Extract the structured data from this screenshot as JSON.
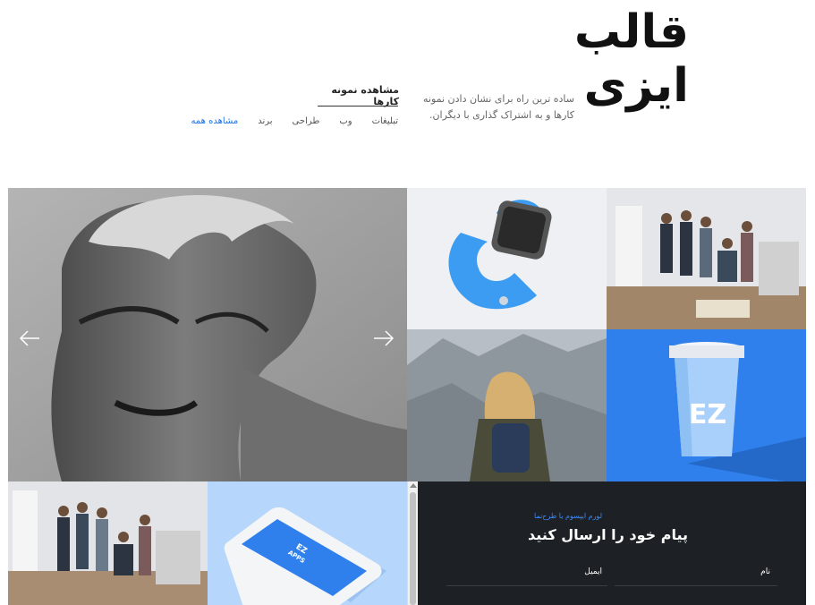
{
  "header": {
    "site_title": "قالب ایزی",
    "tagline": "ساده ترین راه برای نشان دادن نمونه کارها و به اشتراک گذاری با دیگران.",
    "portfolio_heading": "مشاهده نمونه کارها"
  },
  "filters": [
    {
      "label": "مشاهده همه",
      "active": true
    },
    {
      "label": "برند",
      "active": false
    },
    {
      "label": "طراحی",
      "active": false
    },
    {
      "label": "وب",
      "active": false
    },
    {
      "label": "تبلیغات",
      "active": false
    }
  ],
  "gallery": {
    "cup_logo": "EZ",
    "phone_logo_line1": "EZ",
    "phone_logo_line2": "APPS"
  },
  "contact": {
    "kicker": "لورم ایپسوم یا طرح‌نما",
    "title": "پیام خود را ارسال کنید",
    "name_label": "نام",
    "email_label": "ایمیل"
  },
  "colors": {
    "accent": "#1e73e8",
    "dark": "#1d2024",
    "blue_tile": "#2f80ed"
  }
}
